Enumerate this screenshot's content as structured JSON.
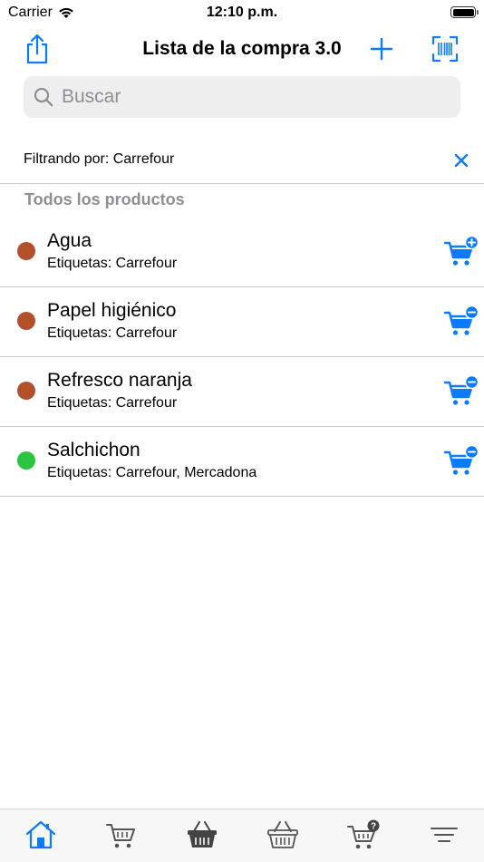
{
  "status": {
    "carrier": "Carrier",
    "time": "12:10 p.m."
  },
  "nav": {
    "title": "Lista de la compra 3.0"
  },
  "search": {
    "placeholder": "Buscar"
  },
  "filter": {
    "text": "Filtrando por: Carrefour"
  },
  "section": {
    "header": "Todos los productos"
  },
  "colors": {
    "accent": "#0a7aff",
    "brown": "#b2502b",
    "green": "#2bc441"
  },
  "products": [
    {
      "name": "Agua",
      "tags": "Etiquetas: Carrefour",
      "dot_color": "#b2502b",
      "cart_action": "cart-plus"
    },
    {
      "name": "Papel higiénico",
      "tags": "Etiquetas: Carrefour",
      "dot_color": "#b2502b",
      "cart_action": "cart-minus"
    },
    {
      "name": "Refresco naranja",
      "tags": "Etiquetas: Carrefour",
      "dot_color": "#b2502b",
      "cart_action": "cart-minus"
    },
    {
      "name": "Salchichon",
      "tags": "Etiquetas: Carrefour, Mercadona",
      "dot_color": "#2bc441",
      "cart_action": "cart-minus"
    }
  ],
  "tabs": [
    {
      "icon": "home-icon",
      "selected": true
    },
    {
      "icon": "cart-icon",
      "selected": false
    },
    {
      "icon": "basket-icon",
      "selected": false
    },
    {
      "icon": "basket-outline-icon",
      "selected": false
    },
    {
      "icon": "cart-question-icon",
      "selected": false
    },
    {
      "icon": "menu-lines-icon",
      "selected": false
    }
  ]
}
